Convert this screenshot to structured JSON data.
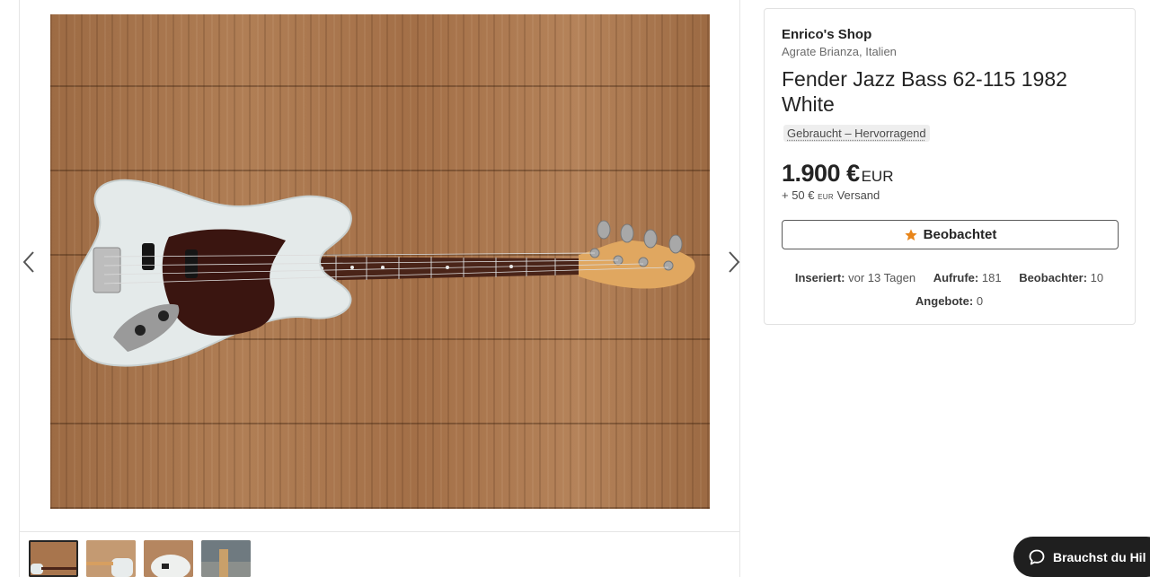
{
  "gallery": {
    "main_image_alt": "Fender Jazz Bass 62-115 1982 White",
    "thumbnails": [
      "thumb-1",
      "thumb-2",
      "thumb-3",
      "thumb-4"
    ]
  },
  "shop": {
    "name": "Enrico's Shop",
    "location": "Agrate Brianza, Italien"
  },
  "listing": {
    "title": "Fender Jazz Bass 62-115 1982 White",
    "condition": "Gebraucht – Hervorragend",
    "price": "1.900 €",
    "price_currency": "EUR",
    "shipping_prefix": "+ 50 €",
    "shipping_currency": "EUR",
    "shipping_suffix": "Versand",
    "watch_label": "Beobachtet"
  },
  "stats": {
    "listed_label": "Inseriert:",
    "listed_value": "vor 13 Tagen",
    "views_label": "Aufrufe:",
    "views_value": "181",
    "watchers_label": "Beobachter:",
    "watchers_value": "10",
    "offers_label": "Angebote:",
    "offers_value": "0"
  },
  "help": {
    "label": "Brauchst du Hil"
  },
  "colors": {
    "accent_star": "#e8851a",
    "help_bg": "#1f1f1f"
  },
  "icons": {
    "prev": "chevron-left-icon",
    "next": "chevron-right-icon",
    "watch": "star-icon",
    "help": "chat-bubble-icon"
  }
}
